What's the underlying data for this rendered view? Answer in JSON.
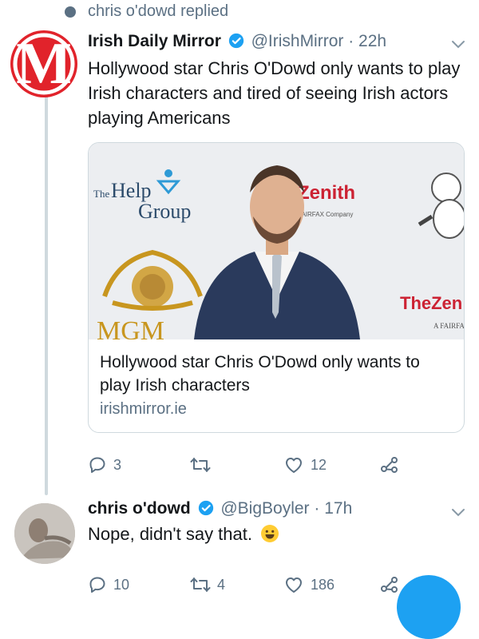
{
  "context": {
    "label": "chris o'dowd replied"
  },
  "original_tweet": {
    "author_name": "Irish Daily Mirror",
    "handle": "@IrishMirror",
    "time": "· 22h",
    "text": "Hollywood star Chris O'Dowd only wants to play Irish characters and tired of seeing Irish actors playing Americans",
    "avatar_letter": "M",
    "card": {
      "title": "Hollywood star Chris O'Dowd only wants to play Irish characters",
      "domain": "irishmirror.ie"
    },
    "actions": {
      "replies": "3",
      "retweets": "",
      "likes": "12"
    }
  },
  "reply_tweet": {
    "author_name": "chris o'dowd",
    "handle": "@BigBoyler",
    "time": "· 17h",
    "text": "Nope, didn't say that.",
    "actions": {
      "replies": "10",
      "retweets": "4",
      "likes": "186"
    }
  },
  "colors": {
    "accent": "#1da1f2",
    "muted": "#5b7083",
    "brand_red": "#e1232b",
    "divider": "#cfd9de"
  },
  "icons": [
    "reply-icon",
    "retweet-icon",
    "like-icon",
    "share-icon",
    "verified-badge-icon",
    "chevron-down-icon",
    "smiley-emoji-icon"
  ]
}
